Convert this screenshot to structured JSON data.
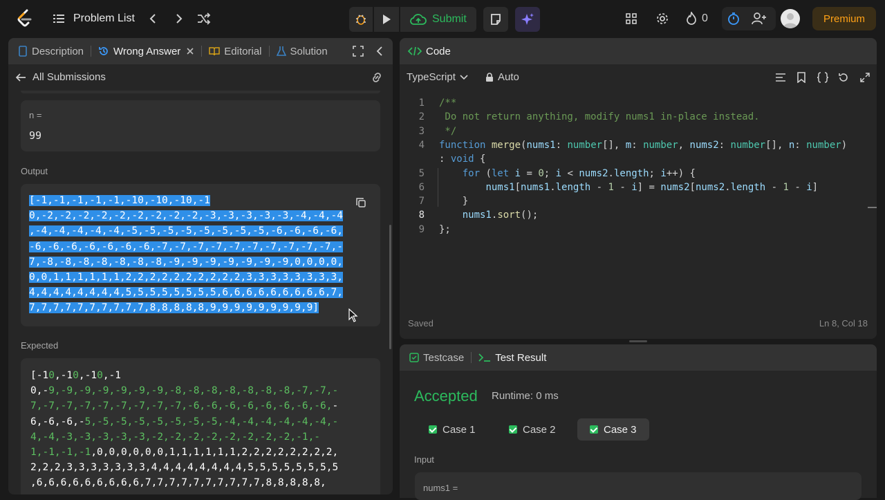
{
  "topbar": {
    "problem_list": "Problem List",
    "submit": "Submit",
    "streak_count": "0",
    "premium": "Premium"
  },
  "left": {
    "tabs": [
      {
        "label": "Description"
      },
      {
        "label": "Wrong Answer"
      },
      {
        "label": "Editorial"
      },
      {
        "label": "Solution"
      }
    ],
    "back_label": "All Submissions",
    "n_label": "n =",
    "n_value": "99",
    "output_label": "Output",
    "output_lines": [
      "[-1,-1,-1,-1,-1,-10,-10,-10,-1",
      "0,-2,-2,-2,-2,-2,-2,-2,-2,-2,-3,-3,-3,-3,-3,-4,-4,-4",
      ",-4,-4,-4,-4,-4,-5,-5,-5,-5,-5,-5,-5,-5,-6,-6,-6,-6,",
      "-6,-6,-6,-6,-6,-6,-6,-7,-7,-7,-7,-7,-7,-7,-7,-7,-7,-",
      "7,-8,-8,-8,-8,-8,-8,-8,-9,-9,-9,-9,-9,-9,-9,0,0,0,0,",
      "0,0,1,1,1,1,1,1,2,2,2,2,2,2,2,2,2,2,3,3,3,3,3,3,3,3,",
      "4,4,4,4,4,4,4,4,5,5,5,5,5,5,5,5,6,6,6,6,6,6,6,6,6,7,",
      "7,7,7,7,7,7,7,7,7,7,8,8,8,8,8,9,9,9,9,9,9,9,9,9]"
    ],
    "expected_label": "Expected",
    "expected_lines": [
      [
        "[-1",
        "0",
        ",-1",
        "0",
        ",-1",
        "0",
        ",-1"
      ],
      [
        "0,-",
        "9,-9,-9,-9,-9,-9,-9,-8,-8,-8,-8,-8,-8,-8,-7,-7,-",
        "",
        "",
        "",
        "",
        ""
      ],
      [
        "",
        "7,-7,-7,-7,-7,-7,-7,-7,-7,-6,-6,-6,-6,-6,-6,-6,-6,",
        "-",
        "",
        "",
        "",
        ""
      ],
      [
        "6,-6,-6,-",
        "5,-5,-5,-5,-5,-5,-5,-5,-4,-4,-4,-4,-4,-4,-",
        "",
        "",
        "",
        "",
        ""
      ],
      [
        "",
        "4,-4,-3,-3,-3,-3,-3,-2,-2,-2,-2,-2,-2,-2,-2,-1,-",
        "",
        "",
        "",
        "",
        ""
      ],
      [
        "",
        "1,-1,-1,-1",
        ",0,0,0,0,0,0,1,1,1,1,1,1,2,2,2,2,2,2,2,2,",
        "",
        "",
        "",
        ""
      ],
      [
        "2,2,2,3,3,3,3,3,3,3,4,4,4,4,4,4,4,4,5,5,5,5,5,5,5,5",
        "",
        "",
        "",
        "",
        "",
        ""
      ],
      [
        ",6,6,6,6,6,6,6,6,6,7,7,7,7,7,7,7,7,7,7,8,8,8,8,8,",
        "",
        "",
        "",
        "",
        "",
        ""
      ]
    ]
  },
  "code": {
    "title": "Code",
    "language": "TypeScript",
    "mode": "Auto",
    "saved": "Saved",
    "cursor": "Ln 8, Col 18",
    "line_numbers": [
      "1",
      "2",
      "3",
      "4",
      "",
      "5",
      "6",
      "7",
      "8",
      "9"
    ]
  },
  "result": {
    "tab_testcase": "Testcase",
    "tab_result": "Test Result",
    "status": "Accepted",
    "runtime": "Runtime: 0 ms",
    "cases": [
      "Case 1",
      "Case 2",
      "Case 3"
    ],
    "input_label": "Input",
    "nums1_label": "nums1 ="
  },
  "colors": {
    "accent_green": "#2cbb5d",
    "premium_orange": "#ffa116",
    "selection_blue": "#2f8fe8"
  }
}
